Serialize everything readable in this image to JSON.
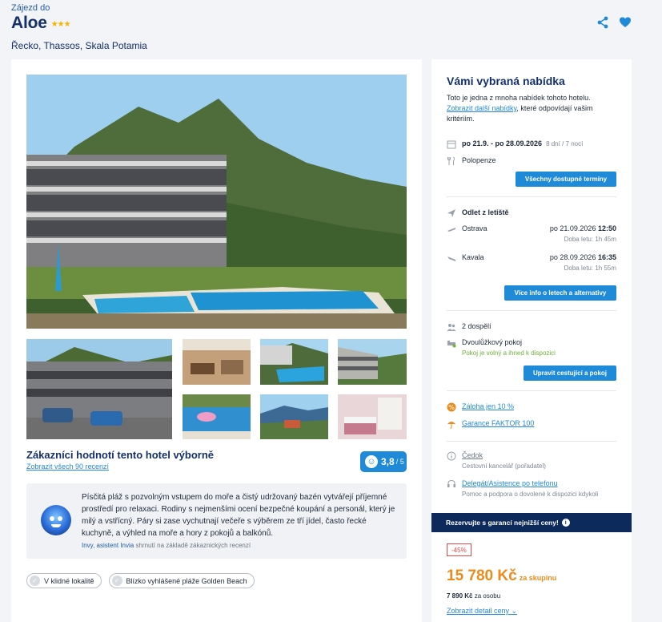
{
  "header": {
    "tour_label": "Zájezd do",
    "hotel_name": "Aloe",
    "stars": "★★★",
    "location": "Řecko, Thassos, Skala Potamia"
  },
  "rating": {
    "title": "Zákazníci hodnotí tento hotel výborně",
    "reviews_link": "Zobrazit všech 90 recenzí",
    "score": "3,8",
    "max": "/ 5"
  },
  "ai_summary": {
    "text": "Písčitá pláž s pozvolným vstupem do moře a čistý udržovaný bazén vytvářejí příjemné prostředí pro relaxaci. Rodiny s nejmenšími ocení bezpečné koupání a personál, který je milý a vstřícný. Páry si zase vychutnají večeře s výběrem ze tří jídel, často řecké kuchyně, a výhled na moře a hory z pokojů a balkónů.",
    "author": "Invy, asistent Invia",
    "note": "shrnutí na základě zákaznických recenzí"
  },
  "tags": [
    {
      "label": "V klidné lokalitě"
    },
    {
      "label": "Blízko vyhlášené pláže Golden Beach"
    }
  ],
  "offer": {
    "title": "Vámi vybraná nabídka",
    "desc_pre": "Toto je jedna z mnoha nabídek tohoto hotelu.",
    "desc_link": "Zobrazit další nabídky",
    "desc_post": ", které odpovídají vašim kritériím.",
    "dates": "po 21.9. - po 28.09.2026",
    "duration": "8 dní / 7 nocí",
    "board": "Polopenze",
    "all_dates_btn": "Všechny dostupné termíny",
    "departure_label": "Odlet z letiště",
    "flights": [
      {
        "airport": "Ostrava",
        "date": "po 21.09.2026",
        "time": "12:50",
        "duration": "Doba letu: 1h 45m"
      },
      {
        "airport": "Kavala",
        "date": "po 28.09.2026",
        "time": "16:35",
        "duration": "Doba letu: 1h 55m"
      }
    ],
    "flights_btn": "Více info o letech a alternativy",
    "travelers": "2 dospělí",
    "room": "Dvoulůžkový pokoj",
    "room_status": "Pokoj je volný a ihned k dispozici",
    "edit_btn": "Upravit cestující a pokoj",
    "deposit": "Záloha jen 10 %",
    "guarantee": "Garance FAKTOR 100",
    "agency_name": "Čedok",
    "agency_role": "Cestovní kancelář (pořadatel)",
    "delegate_link": "Delegát/Asistence po telefonu",
    "delegate_desc": "Pomoc a podpora o dovolené k dispozici kdykoli",
    "guarantee_bar": "Rezervujte s garancí nejnižší ceny!",
    "discount": "-45%",
    "price": "15 780 Kč",
    "price_unit": "za skupinu",
    "per_person_price": "7 890 Kč",
    "per_person_unit": "za osobu",
    "detail_link": "Zobrazit detail ceny"
  },
  "colors": {
    "navy": "#14306b",
    "accent_blue": "#1f8ad8",
    "price_orange": "#ec8b1b",
    "discount_red": "#e04848",
    "available_green": "#6bb13a"
  }
}
